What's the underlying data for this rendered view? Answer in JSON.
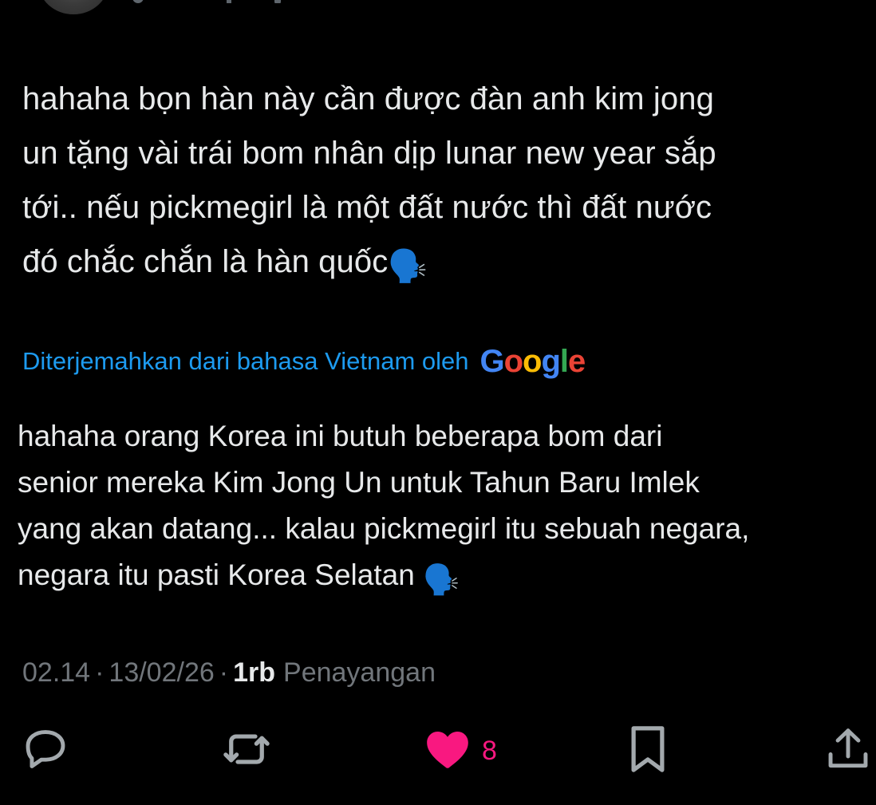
{
  "tweet": {
    "text": "hahaha bọn hàn này cần được đàn anh kim jong\nun tặng vài trái bom nhân dịp lunar new year sắp\ntới.. nếu pickmegirl là một đất nước thì đất nước\nđó chắc chắn là hàn quốc",
    "emoji": "🗣️"
  },
  "translation": {
    "label": "Diterjemahkan dari bahasa Vietnam oleh",
    "provider_letters": [
      "G",
      "o",
      "o",
      "g",
      "l",
      "e"
    ],
    "provider_colors": [
      "#4285F4",
      "#EA4335",
      "#FBBC05",
      "#4285F4",
      "#34A853",
      "#EA4335"
    ],
    "text": "hahaha orang Korea ini butuh beberapa bom dari\nsenior mereka Kim Jong Un untuk Tahun Baru Imlek\nyang akan datang... kalau pickmegirl itu sebuah negara,\nnegara itu pasti Korea Selatan ",
    "emoji": "🗣️"
  },
  "meta": {
    "time": "02.14",
    "separator": "·",
    "date": "13/02/26",
    "views_count": "1rb",
    "views_label": "Penayangan"
  },
  "actions": {
    "reply_icon": "speech-bubble-icon",
    "retweet_icon": "repost-arrows-icon",
    "like_icon": "heart-icon",
    "like_count": "8",
    "like_color": "#f91880",
    "bookmark_icon": "bookmark-icon",
    "share_icon": "share-upload-icon"
  },
  "colors": {
    "background": "#000000",
    "text": "#e7e9ea",
    "secondary": "#71767b",
    "link": "#1d9bf0",
    "icon": "#a3a9ad"
  }
}
